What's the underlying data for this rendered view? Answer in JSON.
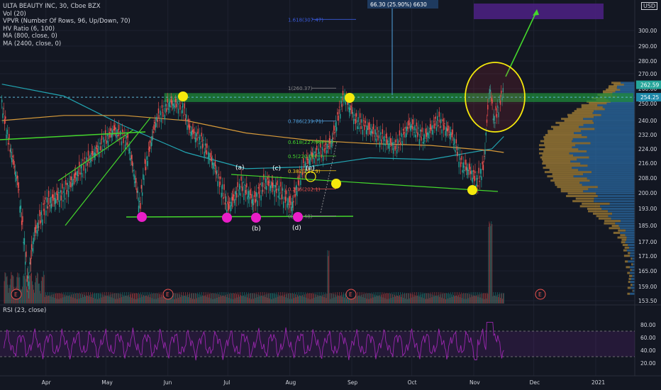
{
  "header": {
    "symbol": "ULTA BEAUTY INC, 30, Cboe BZX",
    "indicators": [
      "Vol (20)",
      "VPVR (Number Of Rows, 96, Up/Down, 70)",
      "HV Ratio (6, 100)",
      "MA (800, close, 0)",
      "MA (2400, close, 0)"
    ],
    "rsi_label": "RSI (23, close)",
    "currency": "USD"
  },
  "measure_label": "66.30 (25.90%) 6630",
  "colors": {
    "background": "#131722",
    "up": "#26a69a",
    "down": "#ef5350",
    "ma_orange": "#d89b3a",
    "ma_teal": "#22a6b3",
    "trend_green": "#44d62c",
    "pink": "#e91ec8",
    "yellow": "#f5e90c",
    "rsi": "#9c27b0",
    "resistance": "#1f8b3a"
  },
  "chart_data": {
    "type": "line",
    "title": "ULTA BEAUTY INC, 30, Cboe BZX",
    "xlabel": "",
    "ylabel": "",
    "x_ticks": [
      "Apr",
      "May",
      "Jun",
      "Jul",
      "Aug",
      "Sep",
      "Oct",
      "Nov",
      "Dec",
      "2021"
    ],
    "y_ticks": [
      300.0,
      290.0,
      280.0,
      270.0,
      260.0,
      250.0,
      240.0,
      232.0,
      224.0,
      216.0,
      208.0,
      200.0,
      193.0,
      185.0,
      177.0,
      171.0,
      165.0,
      159.0,
      153.5
    ],
    "ylim": [
      153.5,
      318
    ],
    "last_price": 262.59,
    "resistance_level": 254.25,
    "series": [
      {
        "x": [
          "Mar 10",
          "Mar 13",
          "Mar 18",
          "Mar 23",
          "Mar 26",
          "Apr 1",
          "Apr 10",
          "Apr 20",
          "Apr 28",
          "May 5",
          "May 12",
          "May 18",
          "May 20",
          "May 26",
          "Jun 2",
          "Jun 8",
          "Jun 12",
          "Jun 18",
          "Jun 24",
          "Jul 1",
          "Jul 8",
          "Jul 14",
          "Jul 20",
          "Jul 28",
          "Aug 2",
          "Aug 7",
          "Aug 12",
          "Aug 17",
          "Aug 22",
          "Aug 28",
          "Sep 3",
          "Sep 10",
          "Sep 16",
          "Sep 23",
          "Sep 30",
          "Oct 7",
          "Oct 14",
          "Oct 21",
          "Oct 26",
          "Oct 30",
          "Nov 3",
          "Nov 6",
          "Nov 9",
          "Nov 11",
          "Nov 13",
          "Nov 16"
        ],
        "values": [
          250,
          230,
          205,
          160,
          180,
          195,
          200,
          215,
          225,
          235,
          228,
          193,
          210,
          240,
          250,
          249,
          235,
          228,
          215,
          193,
          204,
          196,
          206,
          200,
          194,
          212,
          220,
          222,
          228,
          255,
          240,
          235,
          230,
          225,
          238,
          230,
          240,
          232,
          215,
          212,
          206,
          215,
          262,
          240,
          246,
          260
        ]
      },
      {
        "name": "MA (800, close, 0)",
        "x": [
          "Mar 10",
          "Apr 10",
          "May 10",
          "Jun 10",
          "Jul 10",
          "Aug 10",
          "Sep 10",
          "Oct 10",
          "Nov 10",
          "Nov 16"
        ],
        "values": [
          240,
          243,
          243,
          240,
          233,
          229,
          227,
          226,
          223,
          222
        ]
      },
      {
        "name": "MA (2400, close, 0)",
        "x": [
          "Mar 10",
          "Apr 10",
          "May 10",
          "Jun 10",
          "Jul 10",
          "Aug 10",
          "Sep 10",
          "Oct 10",
          "Nov 10",
          "Nov 16"
        ],
        "values": [
          263,
          255,
          237,
          222,
          213,
          214,
          219,
          218,
          224,
          231
        ]
      }
    ],
    "fibonacci": [
      {
        "label": "1.618(307.47)",
        "value": 307.47
      },
      {
        "label": "1(260.37)",
        "value": 260.37
      },
      {
        "label": "0.786(239.71)",
        "value": 239.71
      },
      {
        "label": "0.618(227.96)",
        "value": 227.96
      },
      {
        "label": "0.5(220.0)",
        "value": 220.0
      },
      {
        "label": "0.382(211.9)",
        "value": 211.9
      },
      {
        "label": "0.236(202.1)",
        "value": 202.1
      },
      {
        "label": "0(189.48)",
        "value": 189.48
      }
    ],
    "wave_labels": [
      "(a)",
      "(b)",
      "(c)",
      "(d)",
      "(e)"
    ],
    "event_marker": "E",
    "rsi": {
      "label": "RSI (23, close)",
      "ticks": [
        80.0,
        60.0,
        40.0,
        20.0
      ],
      "upper": 70,
      "lower": 30
    }
  }
}
